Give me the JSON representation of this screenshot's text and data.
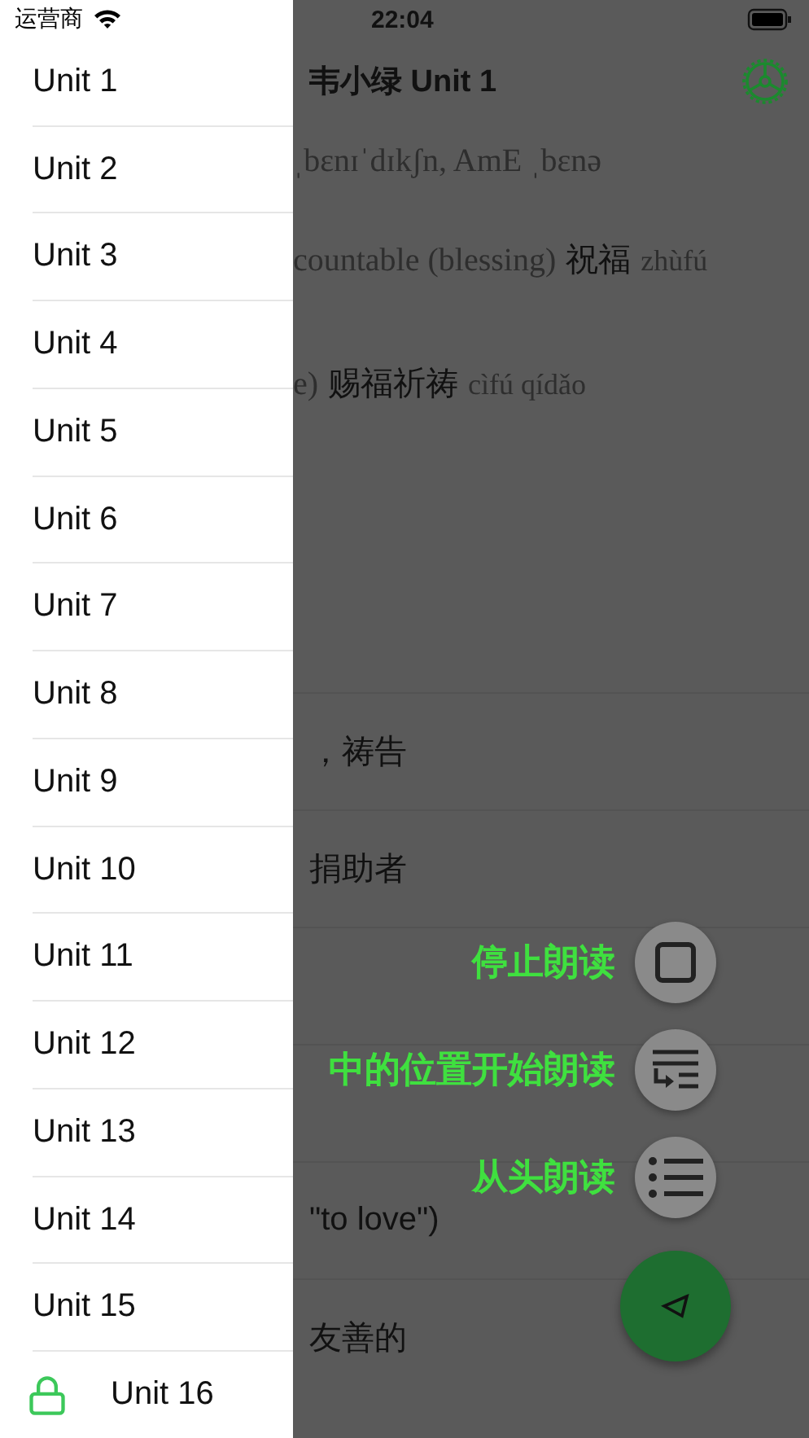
{
  "status_bar": {
    "carrier": "运营商",
    "time": "22:04"
  },
  "drawer": {
    "units": [
      {
        "label": "Unit 1",
        "locked": false
      },
      {
        "label": "Unit 2",
        "locked": false
      },
      {
        "label": "Unit 3",
        "locked": false
      },
      {
        "label": "Unit 4",
        "locked": false
      },
      {
        "label": "Unit 5",
        "locked": false
      },
      {
        "label": "Unit 6",
        "locked": false
      },
      {
        "label": "Unit 7",
        "locked": false
      },
      {
        "label": "Unit 8",
        "locked": false
      },
      {
        "label": "Unit 9",
        "locked": false
      },
      {
        "label": "Unit 10",
        "locked": false
      },
      {
        "label": "Unit 11",
        "locked": false
      },
      {
        "label": "Unit 12",
        "locked": false
      },
      {
        "label": "Unit 13",
        "locked": false
      },
      {
        "label": "Unit 14",
        "locked": false
      },
      {
        "label": "Unit 15",
        "locked": false
      },
      {
        "label": "Unit 16",
        "locked": true
      }
    ]
  },
  "header": {
    "title": "韦小绿 Unit 1"
  },
  "entry": {
    "lines": [
      [
        {
          "kind": "gloss",
          "text": "ˌbɛnɪˈdɪkʃn, AmE ˌbɛnə"
        }
      ],
      [
        {
          "kind": "gloss",
          "text": "countable (blessing)"
        },
        {
          "kind": "hanzi",
          "text": "祝福"
        },
        {
          "kind": "pinyin",
          "text": "zhùfú"
        }
      ],
      [
        {
          "kind": "gloss",
          "text": "e)"
        },
        {
          "kind": "hanzi",
          "text": "赐福祈祷"
        },
        {
          "kind": "pinyin",
          "text": "cìfú qídǎo"
        }
      ]
    ]
  },
  "rows": [
    "，祷告",
    "捐助者",
    "",
    "",
    "\"to love\")",
    "友善的"
  ],
  "reading_actions": [
    {
      "label": "停止朗读",
      "kind": "stop"
    },
    {
      "label": "中的位置开始朗读",
      "kind": "from_position"
    },
    {
      "label": "从头朗读",
      "kind": "from_start"
    }
  ]
}
